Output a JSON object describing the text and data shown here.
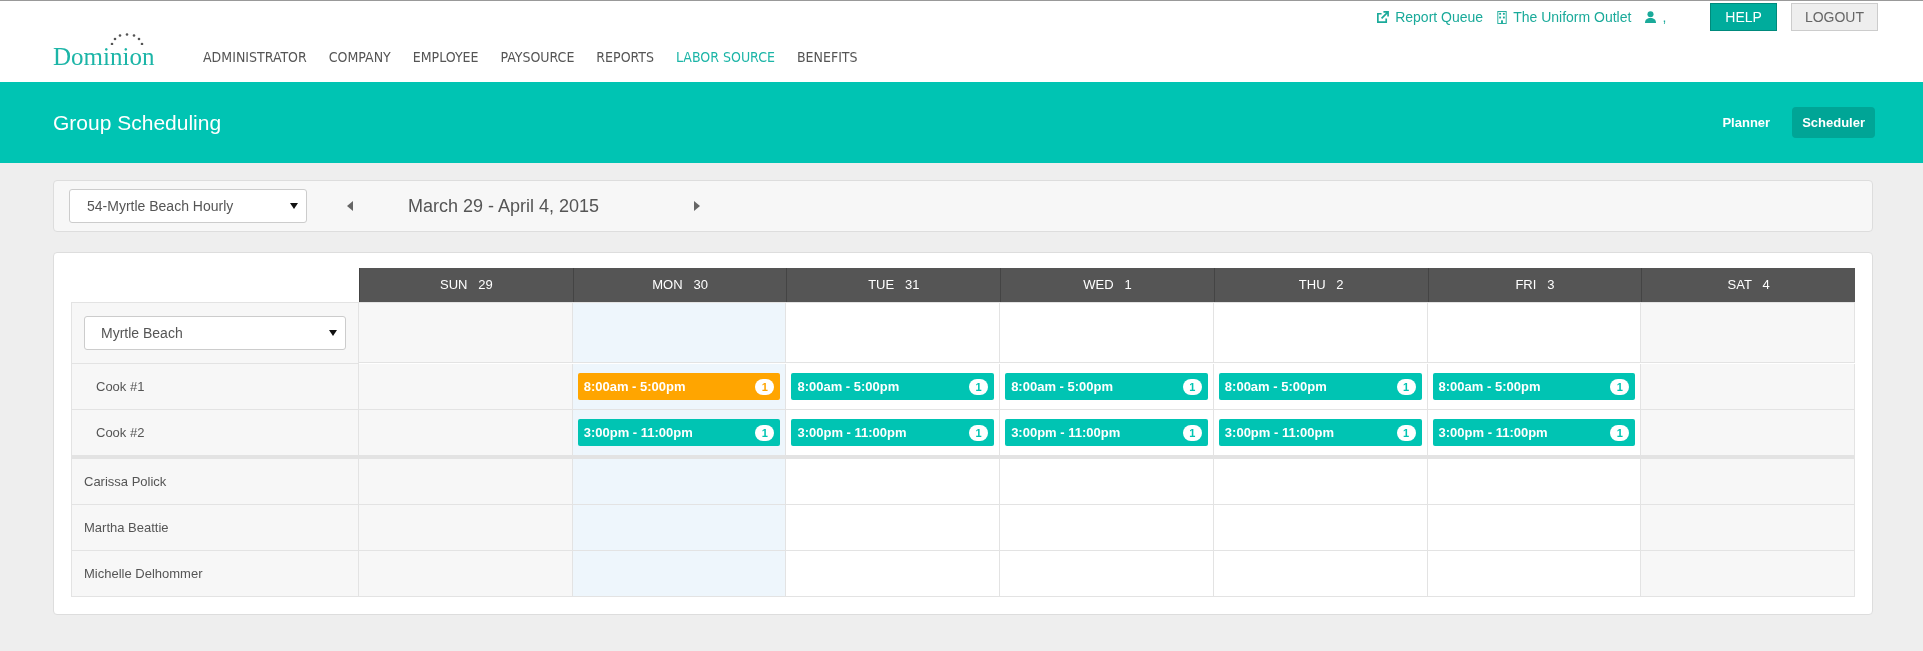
{
  "header": {
    "logo": "Dominion",
    "nav": [
      {
        "label": "ADMINISTRATOR",
        "selected": false
      },
      {
        "label": "COMPANY",
        "selected": false
      },
      {
        "label": "EMPLOYEE",
        "selected": false
      },
      {
        "label": "PAYSOURCE",
        "selected": false
      },
      {
        "label": "REPORTS",
        "selected": false
      },
      {
        "label": "LABOR SOURCE",
        "selected": true
      },
      {
        "label": "BENEFITS",
        "selected": false
      }
    ],
    "top_links": {
      "report_queue": "Report Queue",
      "company": "The Uniform Outlet",
      "user": ","
    },
    "help": "HELP",
    "logout": "LOGOUT"
  },
  "banner": {
    "title": "Group Scheduling",
    "views": [
      {
        "label": "Planner",
        "selected": false
      },
      {
        "label": "Scheduler",
        "selected": true
      }
    ]
  },
  "toolbar": {
    "schedule_select": "54-Myrtle Beach Hourly",
    "date_range": "March 29 - April 4, 2015"
  },
  "grid": {
    "location_select": "Myrtle Beach",
    "days": [
      {
        "label": "SUN   29",
        "kind": "weekend"
      },
      {
        "label": "MON   30",
        "kind": "today"
      },
      {
        "label": "TUE   31",
        "kind": "weekday"
      },
      {
        "label": "WED   1",
        "kind": "weekday"
      },
      {
        "label": "THU   2",
        "kind": "weekday"
      },
      {
        "label": "FRI   3",
        "kind": "weekday"
      },
      {
        "label": "SAT   4",
        "kind": "weekend"
      }
    ],
    "roles": [
      {
        "name": "Cook #1",
        "cells": [
          {},
          {
            "time": "8:00am - 5:00pm",
            "count": "1",
            "color": "#ffa500"
          },
          {
            "time": "8:00am - 5:00pm",
            "count": "1",
            "color": "#00c4b3"
          },
          {
            "time": "8:00am - 5:00pm",
            "count": "1",
            "color": "#00c4b3"
          },
          {
            "time": "8:00am - 5:00pm",
            "count": "1",
            "color": "#00c4b3"
          },
          {
            "time": "8:00am - 5:00pm",
            "count": "1",
            "color": "#00c4b3"
          },
          {}
        ]
      },
      {
        "name": "Cook #2",
        "cells": [
          {},
          {
            "time": "3:00pm - 11:00pm",
            "count": "1",
            "color": "#00c4b3"
          },
          {
            "time": "3:00pm - 11:00pm",
            "count": "1",
            "color": "#00c4b3"
          },
          {
            "time": "3:00pm - 11:00pm",
            "count": "1",
            "color": "#00c4b3"
          },
          {
            "time": "3:00pm - 11:00pm",
            "count": "1",
            "color": "#00c4b3"
          },
          {
            "time": "3:00pm - 11:00pm",
            "count": "1",
            "color": "#00c4b3"
          },
          {}
        ]
      }
    ],
    "employees": [
      "Carissa Polick",
      "Martha Beattie",
      "Michelle Delhommer"
    ]
  }
}
